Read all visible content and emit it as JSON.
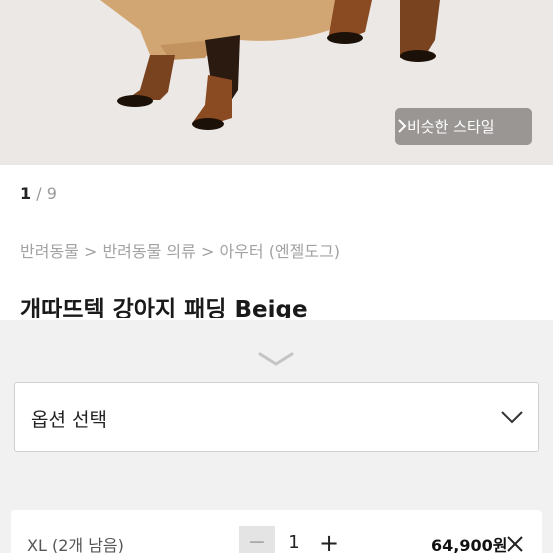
{
  "hero": {
    "similar_button_label": "비슷한 스타일"
  },
  "pager": {
    "current": "1",
    "separator": " / ",
    "total": "9"
  },
  "breadcrumb": {
    "text": "반려동물 > 반려동물 의류 > 아우터 (엔젤도그)"
  },
  "product": {
    "title": "개따뜨텍 강아지 패딩 Beige"
  },
  "option_select": {
    "label": "옵션 선택"
  },
  "selected_item": {
    "name": "XL (2개 남음)",
    "quantity": "1",
    "minus": "−",
    "plus": "+",
    "price": "64,900원"
  }
}
